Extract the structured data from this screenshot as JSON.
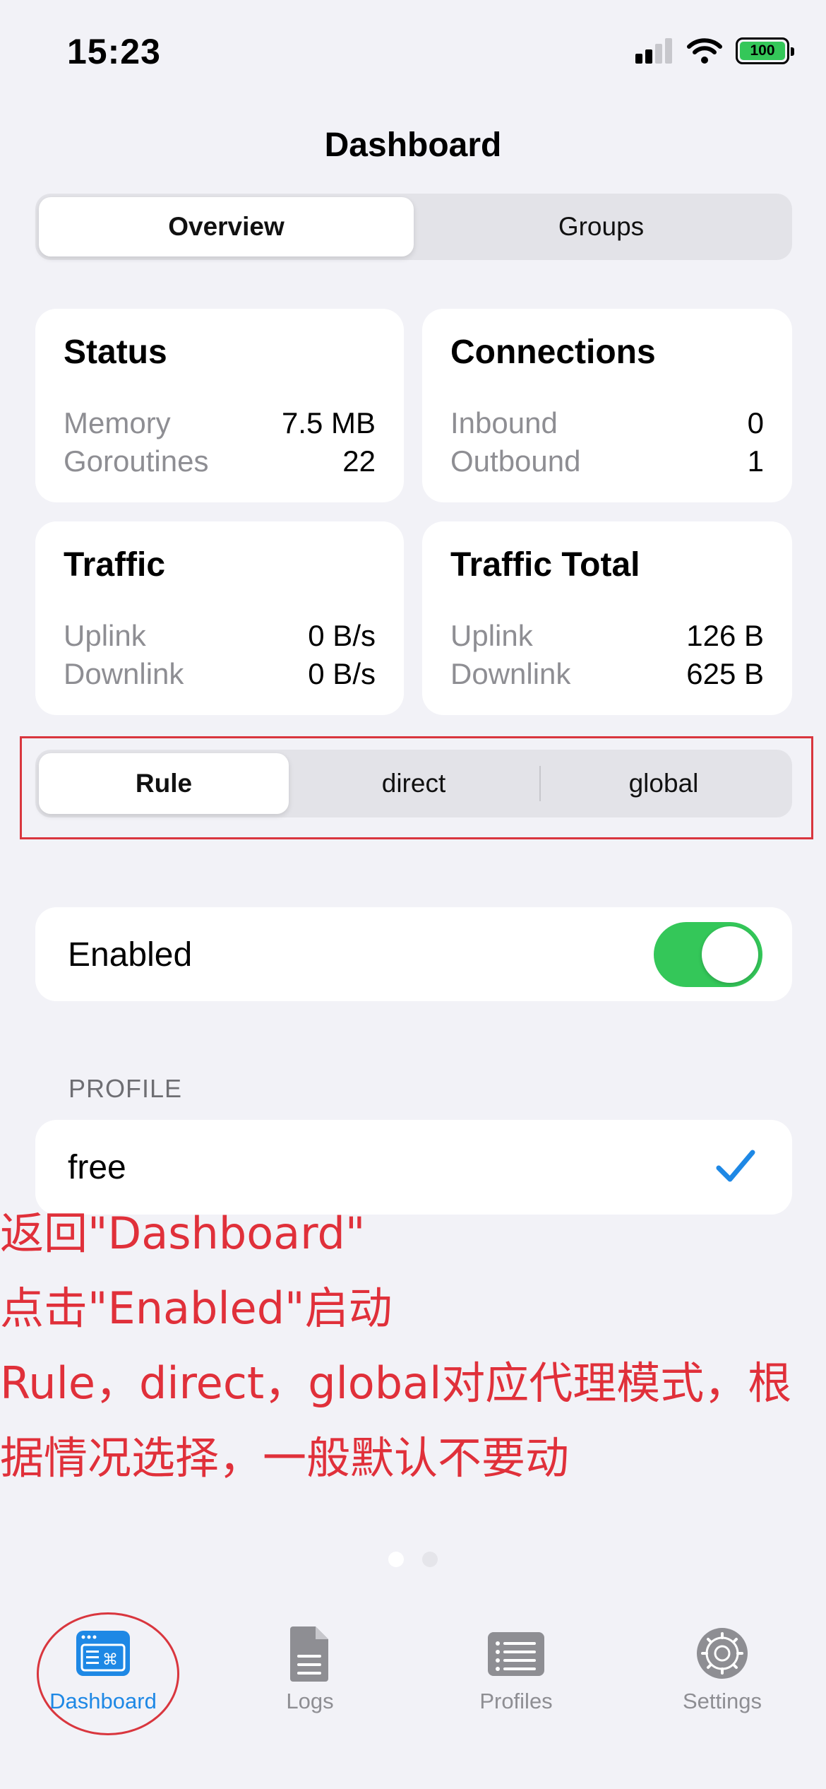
{
  "status_bar": {
    "time": "15:23",
    "battery": "100"
  },
  "nav": {
    "title": "Dashboard"
  },
  "top_segments": [
    {
      "label": "Overview"
    },
    {
      "label": "Groups"
    }
  ],
  "cards": {
    "status": {
      "title": "Status",
      "rows": [
        {
          "k": "Memory",
          "v": "7.5 MB"
        },
        {
          "k": "Goroutines",
          "v": "22"
        }
      ]
    },
    "connections": {
      "title": "Connections",
      "rows": [
        {
          "k": "Inbound",
          "v": "0"
        },
        {
          "k": "Outbound",
          "v": "1"
        }
      ]
    },
    "traffic": {
      "title": "Traffic",
      "rows": [
        {
          "k": "Uplink",
          "v": "0 B/s"
        },
        {
          "k": "Downlink",
          "v": "0 B/s"
        }
      ]
    },
    "traffic_total": {
      "title": "Traffic Total",
      "rows": [
        {
          "k": "Uplink",
          "v": "126 B"
        },
        {
          "k": "Downlink",
          "v": "625 B"
        }
      ]
    }
  },
  "mode_segments": [
    {
      "label": "Rule"
    },
    {
      "label": "direct"
    },
    {
      "label": "global"
    }
  ],
  "enabled": {
    "label": "Enabled",
    "on": true
  },
  "profile_section": {
    "header": "PROFILE",
    "name": "free"
  },
  "annotation": [
    "返回\"Dashboard\"",
    "点击\"Enabled\"启动",
    "Rule，direct，global对应代理模式，根",
    "据情况选择，一般默认不要动"
  ],
  "colors": {
    "accent": "#1e88e5",
    "toggle_on": "#34c759",
    "annotation": "#e0303a"
  },
  "tabs": [
    {
      "label": "Dashboard",
      "icon": "dashboard-icon",
      "active": true
    },
    {
      "label": "Logs",
      "icon": "document-icon",
      "active": false
    },
    {
      "label": "Profiles",
      "icon": "list-icon",
      "active": false
    },
    {
      "label": "Settings",
      "icon": "gear-icon",
      "active": false
    }
  ]
}
